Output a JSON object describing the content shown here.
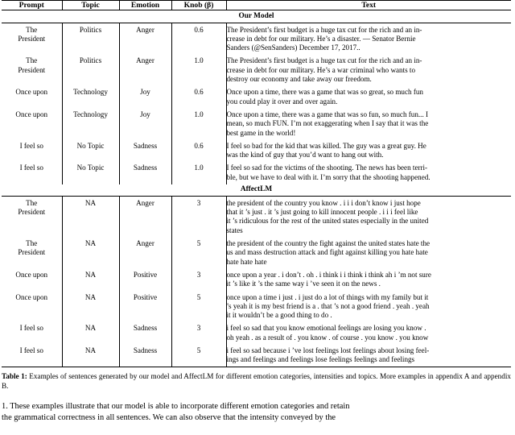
{
  "table": {
    "headers": [
      {
        "label": "Prompt",
        "name": "column-header-prompt"
      },
      {
        "label": "Topic",
        "name": "column-header-topic"
      },
      {
        "label": "Emotion",
        "name": "column-header-emotion"
      },
      {
        "label": "Knob (β)",
        "name": "column-header-knob"
      },
      {
        "label": "Text",
        "name": "column-header-text"
      }
    ],
    "sections": [
      {
        "title": "Our Model",
        "rows": [
          {
            "prompt": [
              "The",
              "President"
            ],
            "topic": "Politics",
            "emotion": "Anger",
            "knob": "0.6",
            "text_lines": [
              "The President’s first budget is a huge tax cut for the rich and an in-",
              "crease in debt for our military.  He’s a disaster.  — Senator Bernie",
              "Sanders (@SenSanders) December 17, 2017.."
            ]
          },
          {
            "prompt": [
              "The",
              "President"
            ],
            "topic": "Politics",
            "emotion": "Anger",
            "knob": "1.0",
            "text_lines": [
              "The President’s first budget is a huge tax cut for the rich and an in-",
              "crease in debt for our military.  He’s a war criminal who wants to",
              "destroy our economy and take away our freedom."
            ]
          },
          {
            "prompt": [
              "Once upon"
            ],
            "topic": "Technology",
            "emotion": "Joy",
            "knob": "0.6",
            "text_lines": [
              "Once upon a time, there was a game that was so great, so much fun",
              "you could play it over and over again."
            ]
          },
          {
            "prompt": [
              "Once upon"
            ],
            "topic": "Technology",
            "emotion": "Joy",
            "knob": "1.0",
            "text_lines": [
              "Once upon a time, there was a game that was so fun, so much fun... I",
              "mean, so much FUN. I’m not exaggerating when I say that it was the",
              "best game in the world!"
            ]
          },
          {
            "prompt": [
              "I feel so"
            ],
            "topic": "No Topic",
            "emotion": "Sadness",
            "knob": "0.6",
            "text_lines": [
              "I feel so bad for the kid that was killed. The guy was a great guy. He",
              "was the kind of guy that you’d want to hang out with."
            ]
          },
          {
            "prompt": [
              "I feel so"
            ],
            "topic": "No Topic",
            "emotion": "Sadness",
            "knob": "1.0",
            "text_lines": [
              "I feel so sad for the victims of the shooting. The news has been terri-",
              "ble, but we have to deal with it. I’m sorry that the shooting happened."
            ]
          }
        ]
      },
      {
        "title": "AffectLM",
        "rows": [
          {
            "prompt": [
              "The",
              "President"
            ],
            "topic": "NA",
            "emotion": "Anger",
            "knob": "3",
            "text_lines": [
              "the president of the country you know .  i i i don’t know i just hope",
              "that it ’s just .  it ’s just going to kill innocent people .  i i i feel like",
              "it ’s ridiculous for the rest of the united states especially in the united",
              "states"
            ]
          },
          {
            "prompt": [
              "The",
              "President"
            ],
            "topic": "NA",
            "emotion": "Anger",
            "knob": "5",
            "text_lines": [
              "the president of the country the fight against the united states hate the",
              "us and mass destruction attack and fight against killing you hate hate",
              "hate hate hate"
            ]
          },
          {
            "prompt": [
              "Once upon"
            ],
            "topic": "NA",
            "emotion": "Positive",
            "knob": "3",
            "text_lines": [
              "once upon a year . i don’t . oh . i think i i think i think ah i ’m not sure",
              "it ’s like it ’s the same way i ’ve seen it on the news ."
            ]
          },
          {
            "prompt": [
              "Once upon"
            ],
            "topic": "NA",
            "emotion": "Positive",
            "knob": "5",
            "text_lines": [
              "once upon a time i just . i just do a lot of things with my family but it",
              "’s yeah it is my best friend is a . that ’s not a good friend . yeah . yeah",
              "it it wouldn’t be a good thing to do ."
            ]
          },
          {
            "prompt": [
              "I feel so"
            ],
            "topic": "NA",
            "emotion": "Sadness",
            "knob": "3",
            "text_lines": [
              "i feel so sad that you know emotional feelings are losing you know .",
              "oh yeah . as a result of . you know . of course . you know . you know"
            ]
          },
          {
            "prompt": [
              "I feel so"
            ],
            "topic": "NA",
            "emotion": "Sadness",
            "knob": "5",
            "text_lines": [
              "i feel so sad because i ’ve lost feelings lost feelings about losing feel-",
              "ings and feelings and feelings lose feelings feelings and feelings"
            ]
          }
        ]
      }
    ]
  },
  "caption": {
    "label": "Table 1:",
    "line1": "Examples of sentences generated by our model and AffectLM for different emotion categories, intensities and topics.",
    "line2": "More examples in appendix A and appendix B."
  },
  "body": {
    "line1": "1. These examples illustrate that our model is able to incorporate different emotion categories and retain",
    "line2": "the grammatical correctness in all sentences.  We can also observe that the intensity conveyed by the"
  }
}
